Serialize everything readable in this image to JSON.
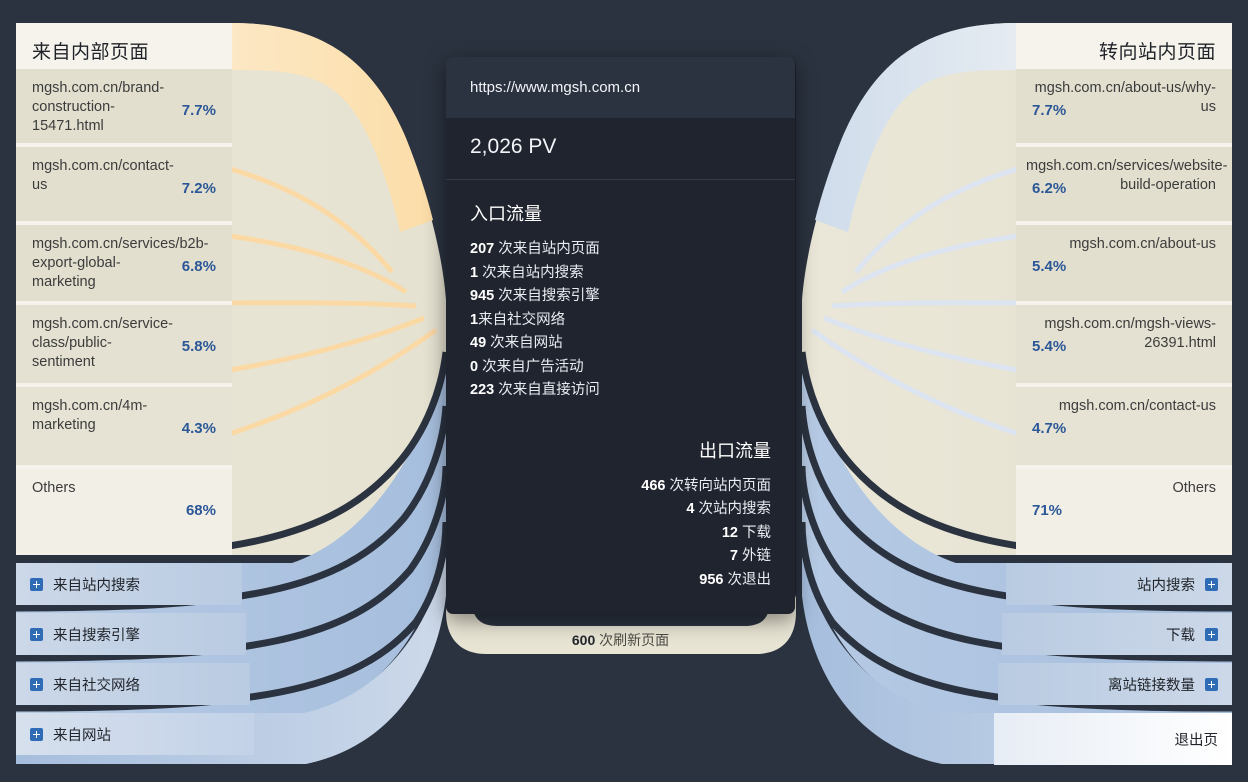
{
  "theme": {
    "bg": "#2b3340",
    "panel_light": "#f5f3ec",
    "node_beige": "#e2dfcf",
    "node_blue": "#c3d2e8",
    "ribbon_orange": "#fbd9a5",
    "ribbon_blue": "#a9c2e0",
    "pct_color": "#2b5797",
    "tooltip_bg": "#20242e",
    "tooltip_header_bg": "#2b3340"
  },
  "left_panel": {
    "title": "来自内部页面",
    "nodes": [
      {
        "label": "mgsh.com.cn/brand-construction-15471.html",
        "pct": "7.7%"
      },
      {
        "label": "mgsh.com.cn/contact-us",
        "pct": "7.2%"
      },
      {
        "label": "mgsh.com.cn/services/b2b-export-global-marketing",
        "pct": "6.8%"
      },
      {
        "label": "mgsh.com.cn/service-class/public-sentiment",
        "pct": "5.8%"
      },
      {
        "label": "mgsh.com.cn/4m-marketing",
        "pct": "4.3%"
      },
      {
        "label": "Others",
        "pct": "68%"
      }
    ],
    "groups": [
      {
        "label": "来自站内搜索",
        "icon": "plus-icon"
      },
      {
        "label": "来自搜索引擎",
        "icon": "plus-icon"
      },
      {
        "label": "来自社交网络",
        "icon": "plus-icon"
      },
      {
        "label": "来自网站",
        "icon": "plus-icon"
      }
    ]
  },
  "right_panel": {
    "title": "转向站内页面",
    "nodes": [
      {
        "label": "mgsh.com.cn/about-us/why-us",
        "pct": "7.7%"
      },
      {
        "label": "mgsh.com.cn/services/website-build-operation",
        "pct": "6.2%"
      },
      {
        "label": "mgsh.com.cn/about-us",
        "pct": "5.4%"
      },
      {
        "label": "mgsh.com.cn/mgsh-views-26391.html",
        "pct": "5.4%"
      },
      {
        "label": "mgsh.com.cn/contact-us",
        "pct": "4.7%"
      },
      {
        "label": "Others",
        "pct": "71%"
      }
    ],
    "groups": [
      {
        "label": "站内搜索",
        "icon": "plus-icon"
      },
      {
        "label": "下载",
        "icon": "plus-icon"
      },
      {
        "label": "离站链接数量",
        "icon": "plus-icon"
      },
      {
        "label": "退出页",
        "icon": ""
      }
    ]
  },
  "tooltip": {
    "url": "https://www.mgsh.com.cn",
    "pv": "2,026 PV",
    "inbound_title": "入口流量",
    "inbound": [
      {
        "value": "207",
        "label": "次来自站内页面"
      },
      {
        "value": "1",
        "label": "次来自站内搜索"
      },
      {
        "value": "945",
        "label": "次来自搜索引擎"
      },
      {
        "value": "1",
        "label": "来自社交网络"
      },
      {
        "value": "49",
        "label": "次来自网站"
      },
      {
        "value": "0",
        "label": "次来自广告活动"
      },
      {
        "value": "223",
        "label": "次来自直接访问"
      }
    ],
    "outbound_title": "出口流量",
    "outbound": [
      {
        "value": "466",
        "label": "次转向站内页面"
      },
      {
        "value": "4",
        "label": "次站内搜索"
      },
      {
        "value": "12",
        "label": "下载"
      },
      {
        "value": "7",
        "label": "外链"
      },
      {
        "value": "956",
        "label": "次退出"
      }
    ]
  },
  "refresh": {
    "value": "600",
    "label": "次刷新页面"
  },
  "chart_data": {
    "type": "sankey",
    "title": "Users Flow - https://www.mgsh.com.cn",
    "center_node": {
      "name": "https://www.mgsh.com.cn",
      "pv": 2026
    },
    "sources": [
      {
        "name": "mgsh.com.cn/brand-construction-15471.html",
        "pct": 7.7
      },
      {
        "name": "mgsh.com.cn/contact-us",
        "pct": 7.2
      },
      {
        "name": "mgsh.com.cn/services/b2b-export-global-marketing",
        "pct": 6.8
      },
      {
        "name": "mgsh.com.cn/service-class/public-sentiment",
        "pct": 5.8
      },
      {
        "name": "mgsh.com.cn/4m-marketing",
        "pct": 4.3
      },
      {
        "name": "Others",
        "pct": 68
      },
      {
        "name": "来自站内搜索",
        "pct": null
      },
      {
        "name": "来自搜索引擎",
        "pct": null
      },
      {
        "name": "来自社交网络",
        "pct": null
      },
      {
        "name": "来自网站",
        "pct": null
      }
    ],
    "targets": [
      {
        "name": "mgsh.com.cn/about-us/why-us",
        "pct": 7.7
      },
      {
        "name": "mgsh.com.cn/services/website-build-operation",
        "pct": 6.2
      },
      {
        "name": "mgsh.com.cn/about-us",
        "pct": 5.4
      },
      {
        "name": "mgsh.com.cn/mgsh-views-26391.html",
        "pct": 5.4
      },
      {
        "name": "mgsh.com.cn/contact-us",
        "pct": 4.7
      },
      {
        "name": "Others",
        "pct": 71
      },
      {
        "name": "站内搜索",
        "pct": null
      },
      {
        "name": "下载",
        "pct": null
      },
      {
        "name": "离站链接数量",
        "pct": null
      },
      {
        "name": "退出页",
        "pct": null
      }
    ],
    "inbound_counts": {
      "次来自站内页面": 207,
      "次来自站内搜索": 1,
      "次来自搜索引擎": 945,
      "来自社交网络": 1,
      "次来自网站": 49,
      "次来自广告活动": 0,
      "次来自直接访问": 223
    },
    "outbound_counts": {
      "次转向站内页面": 466,
      "次站内搜索": 4,
      "下载": 12,
      "外链": 7,
      "次退出": 956
    },
    "refresh_count": 600
  }
}
